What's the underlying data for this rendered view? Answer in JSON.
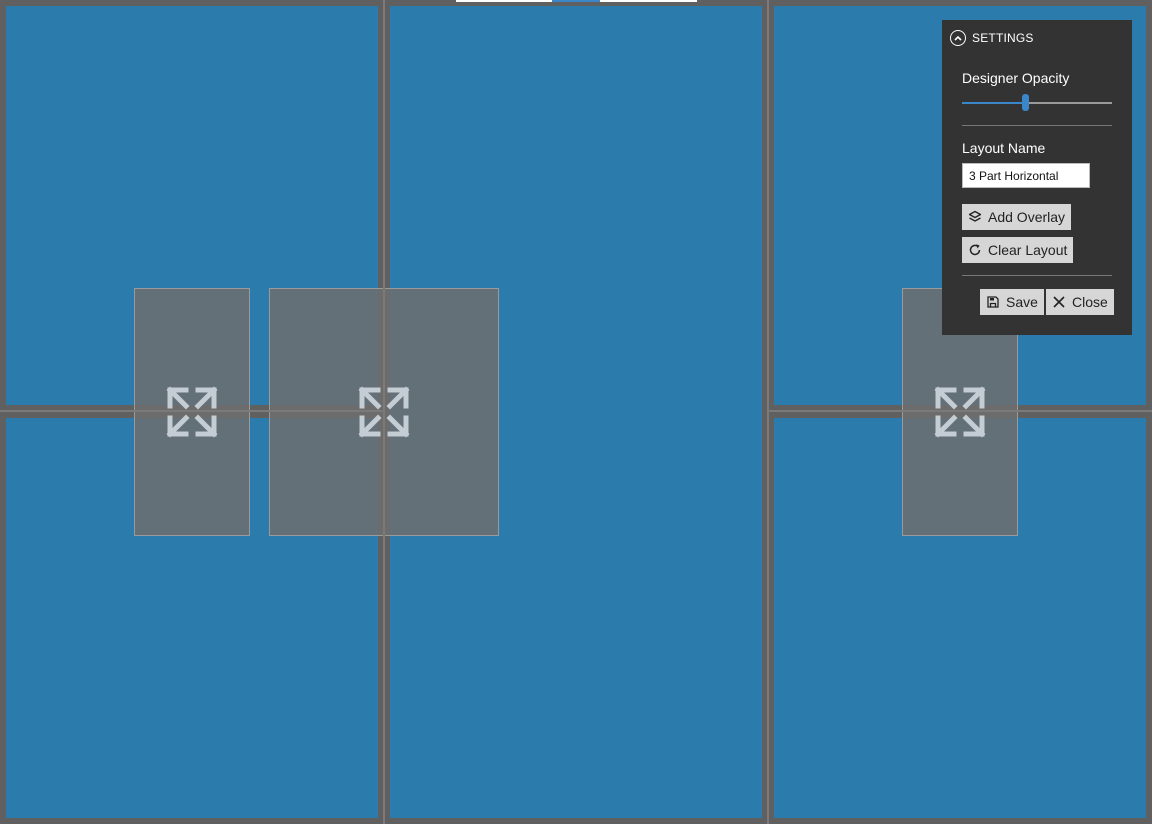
{
  "colors": {
    "background": "#606060",
    "zone": "#2c7bad",
    "overlay": "#6e6e6e",
    "panel": "#333333",
    "accent": "#3a86c8",
    "button": "#d6d6d6"
  },
  "overlays": [
    {
      "icon": "expand-arrows-icon"
    },
    {
      "icon": "expand-arrows-icon"
    },
    {
      "icon": "expand-arrows-icon"
    }
  ],
  "settings": {
    "header": "SETTINGS",
    "opacity_label": "Designer Opacity",
    "opacity_value": 0.42,
    "layout_name_label": "Layout Name",
    "layout_name_value": "3 Part Horizontal",
    "add_overlay": "Add Overlay",
    "clear_layout": "Clear Layout",
    "save": "Save",
    "close": "Close"
  }
}
